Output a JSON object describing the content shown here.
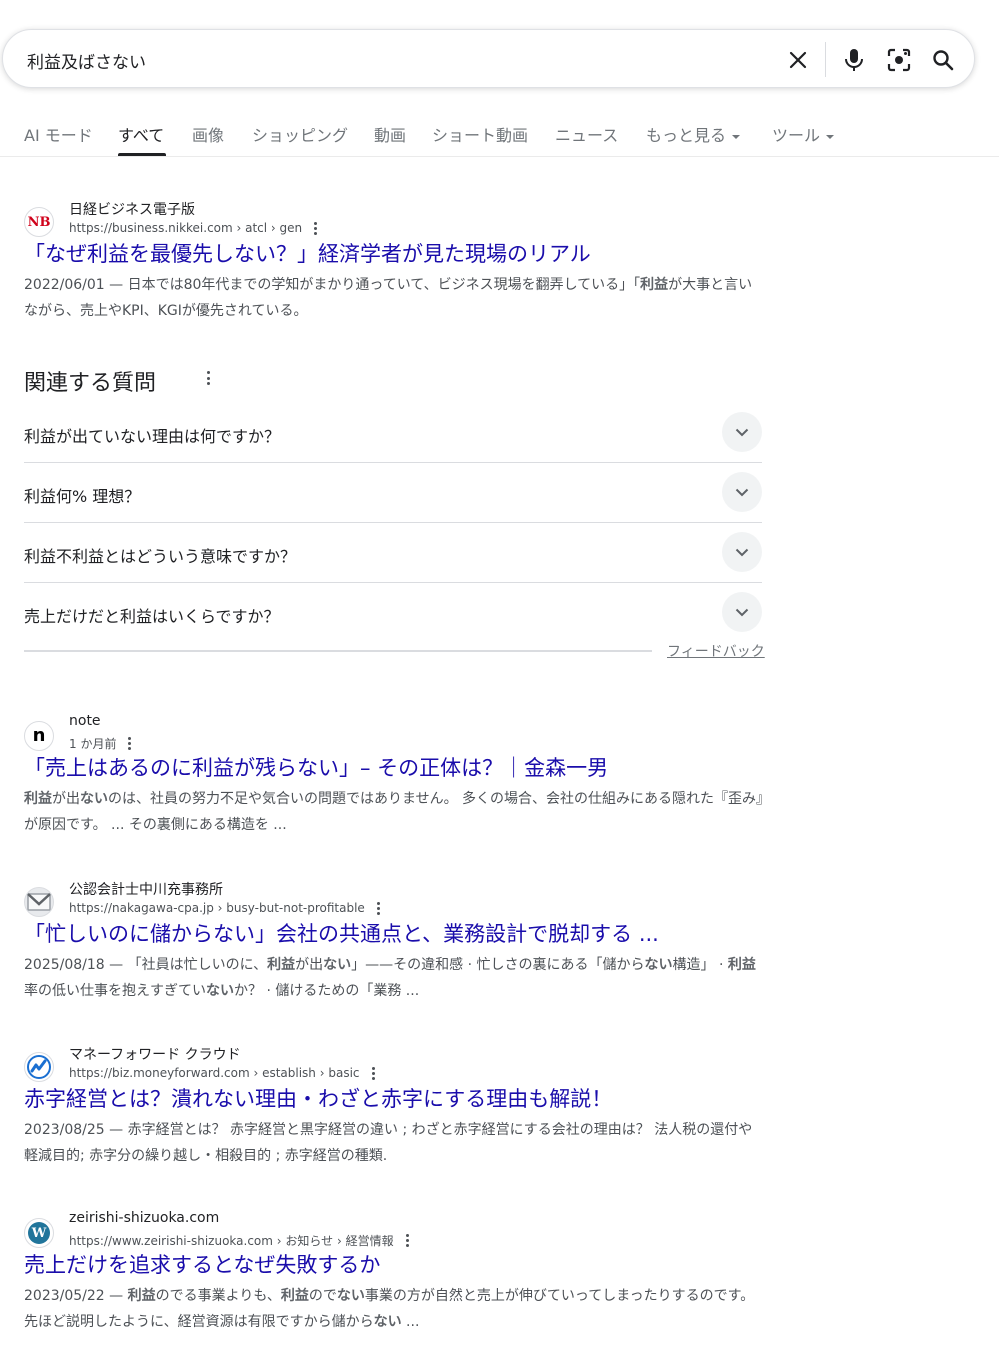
{
  "search": {
    "query": "利益及ばさない"
  },
  "tabs": [
    {
      "label": "AI モード"
    },
    {
      "label": "すべて"
    },
    {
      "label": "画像"
    },
    {
      "label": "ショッピング"
    },
    {
      "label": "動画"
    },
    {
      "label": "ショート動画"
    },
    {
      "label": "ニュース"
    },
    {
      "label": "もっと見る"
    },
    {
      "label": "ツール"
    }
  ],
  "results": [
    {
      "site": "日経ビジネス電子版",
      "url": "https://business.nikkei.com › atcl › gen",
      "title": "「なぜ利益を最優先しない？」経済学者が見た現場のリアル",
      "snippet_html": "2022/06/01 — 日本では80年代までの学知がまかり通っていて、ビジネス現場を翻弄している」「<b>利益</b>が大事と言いながら、売上やKPI、KGIが優先されている。",
      "favicon": "NB"
    },
    {
      "site": "note",
      "url": "1 か月前",
      "title": "「売上はあるのに利益が残らない」– その正体は？｜金森一男",
      "snippet_html": "<b>利益</b>が出<b>ない</b>のは、社員の努力不足や気合いの問題ではありません。 多くの場合、会社の仕組みにある隠れた『歪み』が原因です。 ... その裏側にある構造を ...",
      "favicon": "n"
    },
    {
      "site": "公認会計士中川充事務所",
      "url": "https://nakagawa-cpa.jp › busy-but-not-profitable",
      "title": "「忙しいのに儲からない」会社の共通点と、業務設計で脱却する ...",
      "snippet_html": "2025/08/18 — 「社員は忙しいのに、<b>利益</b>が出<b>ない</b>」——その違和感 · 忙しさの裏にある「儲から<b>ない</b>構造」 · <b>利益</b>率の低い仕事を抱えすぎてい<b>ない</b>か？ · 儲けるための「業務 ...",
      "favicon": "envelope"
    },
    {
      "site": "マネーフォワード クラウド",
      "url": "https://biz.moneyforward.com › establish › basic",
      "title": "赤字経営とは？潰れない理由・わざと赤字にする理由も解説！",
      "snippet_html": "2023/08/25 — 赤字経営とは？ 赤字経営と黒字経営の違い ; わざと赤字経営にする会社の理由は？ 法人税の還付や軽減目的; 赤字分の繰り越し・相殺目的 ; 赤字経営の種類.",
      "favicon": "mf"
    },
    {
      "site": "zeirishi-shizuoka.com",
      "url": "https://www.zeirishi-shizuoka.com › お知らせ › 経営情報",
      "title": "売上だけを追求するとなぜ失敗するか",
      "snippet_html": "2023/05/22 — <b>利益</b>のでる事業よりも、<b>利益</b>ので<b>ない</b>事業の方が自然と売上が伸びていってしまったりするのです。先ほど説明したように、経営資源は有限ですから儲から<b>ない</b> ...",
      "favicon": "W"
    }
  ],
  "paa": {
    "heading": "関連する質問",
    "questions": [
      "利益が出ていない理由は何ですか？",
      "利益何% 理想？",
      "利益不利益とはどういう意味ですか？",
      "売上だけだと利益はいくらですか？"
    ],
    "feedback": "フィードバック"
  }
}
